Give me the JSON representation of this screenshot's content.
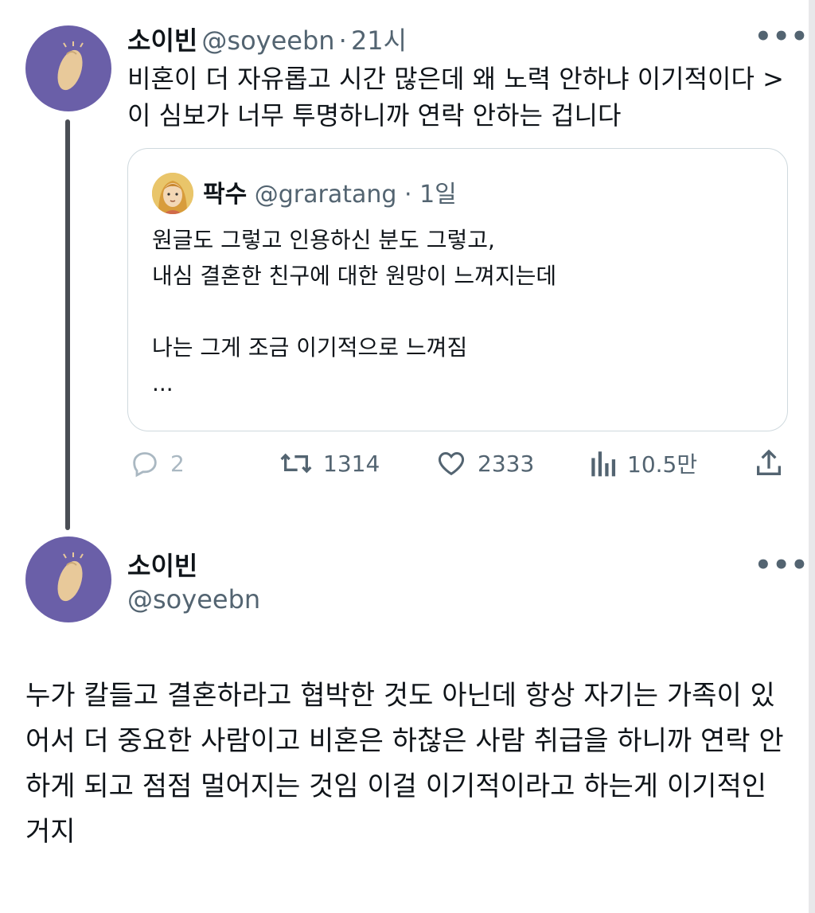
{
  "tweet1": {
    "name": "소이빈",
    "handle": "@soyeebn",
    "separator": "·",
    "time": "21시",
    "text": "비혼이 더 자유롭고 시간 많은데 왜 노력 안하냐 이기적이다 > 이 심보가 너무 투명하니까 연락 안하는 겁니다",
    "more_icon": "more-horizontal-icon",
    "quote": {
      "name": "팍수",
      "handle": "@graratang",
      "separator": "·",
      "time": "1일",
      "text": "원글도 그렇고 인용하신 분도 그렇고,\n내심 결혼한 친구에 대한 원망이 느껴지는데\n\n나는 그게 조금 이기적으로 느껴짐\n..."
    },
    "actions": {
      "reply_count": "2",
      "retweet_count": "1314",
      "like_count": "2333",
      "view_count": "10.5만"
    }
  },
  "tweet2": {
    "name": "소이빈",
    "handle": "@soyeebn",
    "text": "누가 칼들고 결혼하라고 협박한 것도 아닌데 항상 자기는 가족이 있어서 더 중요한 사람이고 비혼은 하찮은 사람 취급을 하니까 연락 안하게 되고 점점 멀어지는 것임 이걸 이기적이라고 하는게 이기적인 거지"
  },
  "colors": {
    "avatar_bg": "#6a5fa8",
    "bean": "#e8c99a",
    "muted_text": "#536471",
    "border": "#cfd9de",
    "thread_line": "#4a4e55"
  }
}
